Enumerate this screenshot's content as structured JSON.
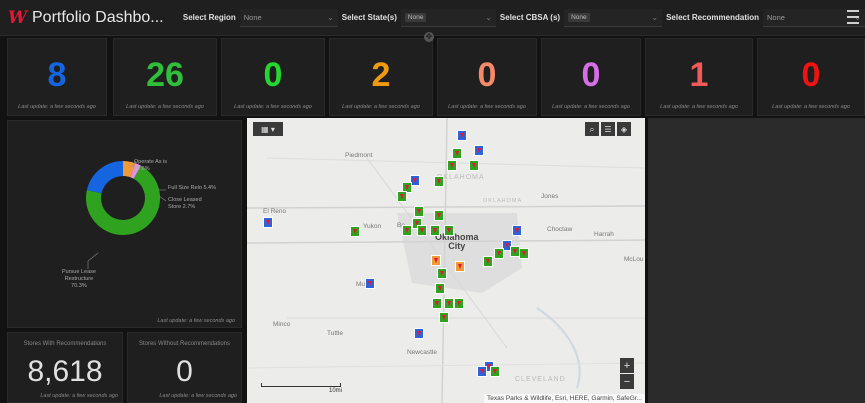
{
  "header": {
    "title": "Portfolio Dashbo...",
    "filters": [
      {
        "label": "Select Region",
        "value": "None",
        "chip": false
      },
      {
        "label": "Select State(s)",
        "value": "None",
        "chip": true
      },
      {
        "label": "Select CBSA (s)",
        "value": "None",
        "chip": true
      },
      {
        "label": "Select Recommendation",
        "value": "None",
        "chip": false
      }
    ]
  },
  "kpis": [
    {
      "value": "8",
      "color": "#1565e0",
      "foot": "Last update: a few seconds ago"
    },
    {
      "value": "26",
      "color": "#2fbf3a",
      "foot": "Last update: a few seconds ago"
    },
    {
      "value": "0",
      "color": "#25d82f",
      "foot": "Last update: a few seconds ago"
    },
    {
      "value": "2",
      "color": "#f09a10",
      "foot": "Last update: a few seconds ago"
    },
    {
      "value": "0",
      "color": "#f58a6a",
      "foot": "Last update: a few seconds ago"
    },
    {
      "value": "0",
      "color": "#d76ee8",
      "foot": "Last update: a few seconds ago"
    },
    {
      "value": "1",
      "color": "#f25a5a",
      "foot": "Last update: a few seconds ago"
    },
    {
      "value": "0",
      "color": "#f01212",
      "foot": "Last update: a few seconds ago"
    }
  ],
  "donut": {
    "segments": [
      {
        "label": "Pursue Lease Restructure",
        "percent": 70.3,
        "color": "#2fa31f"
      },
      {
        "label": "Operate As is",
        "percent": 21.6,
        "color": "#1565e0"
      },
      {
        "label": "Full Size Relo",
        "percent": 5.4,
        "color": "#f09a3a"
      },
      {
        "label": "Close Leased Store",
        "percent": 2.7,
        "color": "#e890e0"
      }
    ],
    "labels": {
      "operate": "Operate As is\n21.6%",
      "fullsize": "Full Size Relo 5.4%",
      "close": "Close Leased\nStore 2.7%",
      "pursue": "Pursue Lease\nRestructure\n70.3%"
    },
    "foot": "Last update: a few seconds ago"
  },
  "stats": [
    {
      "title": "Stores With Recommendations",
      "value": "8,618",
      "foot": "Last update: a few seconds ago"
    },
    {
      "title": "Stores Without Recommendations",
      "value": "0",
      "foot": "Last update: a few seconds ago"
    }
  ],
  "map": {
    "places": {
      "piedmont": "Piedmont",
      "elreno": "El Reno",
      "yukon": "Yukon",
      "okc": "Oklahoma\nCity",
      "oklahoma_region": "OKLAHOMA",
      "jones": "Jones",
      "choctaw": "Choctaw",
      "harrah": "Harrah",
      "mcloud": "McLou",
      "minco": "Minco",
      "tuttle": "Tuttle",
      "mustang": "Mu",
      "newcastle": "Newcastle",
      "cleveland": "CLEVELAND",
      "okcounty": "OKLAHOMA",
      "bethany": "Be"
    },
    "scale_label": "10mi",
    "attribution": "Texas Parks & Wildlife, Esri, HERE, Garmin, SafeGr..."
  }
}
